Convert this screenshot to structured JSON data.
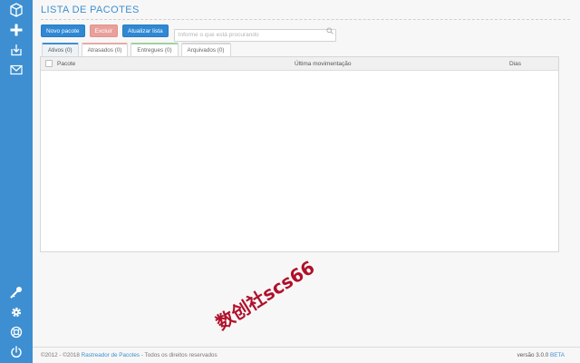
{
  "sidebar": {
    "items": [
      {
        "name": "package-icon"
      },
      {
        "name": "plus-icon"
      },
      {
        "name": "download-icon"
      },
      {
        "name": "mail-icon"
      },
      {
        "name": "key-icon"
      },
      {
        "name": "gear-icon"
      },
      {
        "name": "lifebuoy-icon"
      },
      {
        "name": "power-icon"
      }
    ]
  },
  "header": {
    "title": "LISTA DE PACOTES"
  },
  "toolbar": {
    "new_label": "Novo pacote",
    "delete_label": "Excluir",
    "refresh_label": "Atualizar lista",
    "search_placeholder": "Informe o que está procurando",
    "search_value": ""
  },
  "tabs": [
    {
      "label": "Ativos (0)",
      "active": true
    },
    {
      "label": "Atrasados (0)",
      "active": false
    },
    {
      "label": "Entregues (0)",
      "active": false
    },
    {
      "label": "Arquivados (0)",
      "active": false
    }
  ],
  "table": {
    "columns": [
      "Pacote",
      "Última movimentação",
      "Dias"
    ],
    "rows": []
  },
  "footer": {
    "copyright_prefix": "©2012 - ©2018",
    "brand": "Rastreador de Pacotes",
    "copyright_suffix": " - Todos os direitos reservados",
    "version_label": "versão 3.0.0",
    "beta": "BETA"
  },
  "watermark": {
    "text": "数创社scs66"
  },
  "colors": {
    "sidebar": "#3d8fd1",
    "primary": "#2f88d3",
    "danger": "#e9a09b",
    "late_tab": "#e8aaa5",
    "delivered_tab": "#9ed3a0",
    "watermark": "#b0102a"
  }
}
